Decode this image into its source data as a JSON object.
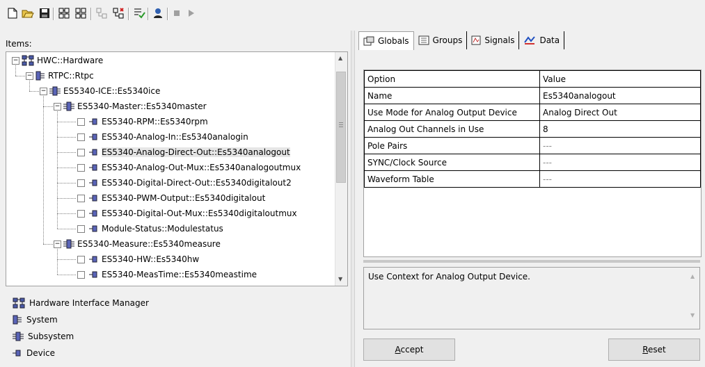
{
  "toolbar": {
    "buttons": [
      "new-icon",
      "open-icon",
      "save-icon",
      "add-system-icon",
      "add-subsystem-icon",
      "import-icon",
      "export-icon",
      "check-icon",
      "user-icon",
      "stop-icon",
      "play-icon"
    ]
  },
  "items_label": "Items:",
  "tree": [
    {
      "label": "HWC::Hardware",
      "kind": "hardware",
      "level": 0,
      "expander": "-"
    },
    {
      "label": "RTPC::Rtpc",
      "kind": "system",
      "level": 1,
      "expander": "-"
    },
    {
      "label": "ES5340-ICE::Es5340ice",
      "kind": "subsystem",
      "level": 2,
      "expander": "-"
    },
    {
      "label": "ES5340-Master::Es5340master",
      "kind": "subsystem",
      "level": 3,
      "expander": "-"
    },
    {
      "label": "ES5340-RPM::Es5340rpm",
      "kind": "device",
      "level": 4
    },
    {
      "label": "ES5340-Analog-In::Es5340analogin",
      "kind": "device",
      "level": 4
    },
    {
      "label": "ES5340-Analog-Direct-Out::Es5340analogout",
      "kind": "device",
      "level": 4,
      "selected": true
    },
    {
      "label": "ES5340-Analog-Out-Mux::Es5340analogoutmux",
      "kind": "device",
      "level": 4
    },
    {
      "label": "ES5340-Digital-Direct-Out::Es5340digitalout2",
      "kind": "device",
      "level": 4
    },
    {
      "label": "ES5340-PWM-Output::Es5340digitalout",
      "kind": "device",
      "level": 4
    },
    {
      "label": "ES5340-Digital-Out-Mux::Es5340digitaloutmux",
      "kind": "device",
      "level": 4
    },
    {
      "label": "Module-Status::Modulestatus",
      "kind": "device",
      "level": 4
    },
    {
      "label": "ES5340-Measure::Es5340measure",
      "kind": "subsystem",
      "level": 3,
      "expander": "-"
    },
    {
      "label": "ES5340-HW::Es5340hw",
      "kind": "device",
      "level": 4
    },
    {
      "label": "ES5340-MeasTime::Es5340meastime",
      "kind": "device",
      "level": 4
    }
  ],
  "legend": [
    {
      "label": "Hardware Interface Manager",
      "kind": "hardware"
    },
    {
      "label": "System",
      "kind": "system"
    },
    {
      "label": "Subsystem",
      "kind": "subsystem"
    },
    {
      "label": "Device",
      "kind": "device"
    }
  ],
  "tabs": [
    {
      "label": "Globals",
      "icon": "globals-icon",
      "active": true
    },
    {
      "label": "Groups",
      "icon": "groups-icon"
    },
    {
      "label": "Signals",
      "icon": "signals-icon"
    },
    {
      "label": "Data",
      "icon": "data-icon"
    }
  ],
  "grid": {
    "headers": [
      "Option",
      "Value"
    ],
    "rows": [
      [
        "Name",
        "Es5340analogout"
      ],
      [
        "Use Mode for Analog Output Device",
        "Analog Direct Out"
      ],
      [
        "Analog Out Channels in Use",
        "8"
      ],
      [
        "Pole Pairs",
        "---"
      ],
      [
        "SYNC/Clock Source",
        "---"
      ],
      [
        "Waveform Table",
        "---"
      ]
    ]
  },
  "description": "Use Context for Analog Output Device.",
  "buttons": {
    "accept": "Accept",
    "reset": "Reset"
  }
}
